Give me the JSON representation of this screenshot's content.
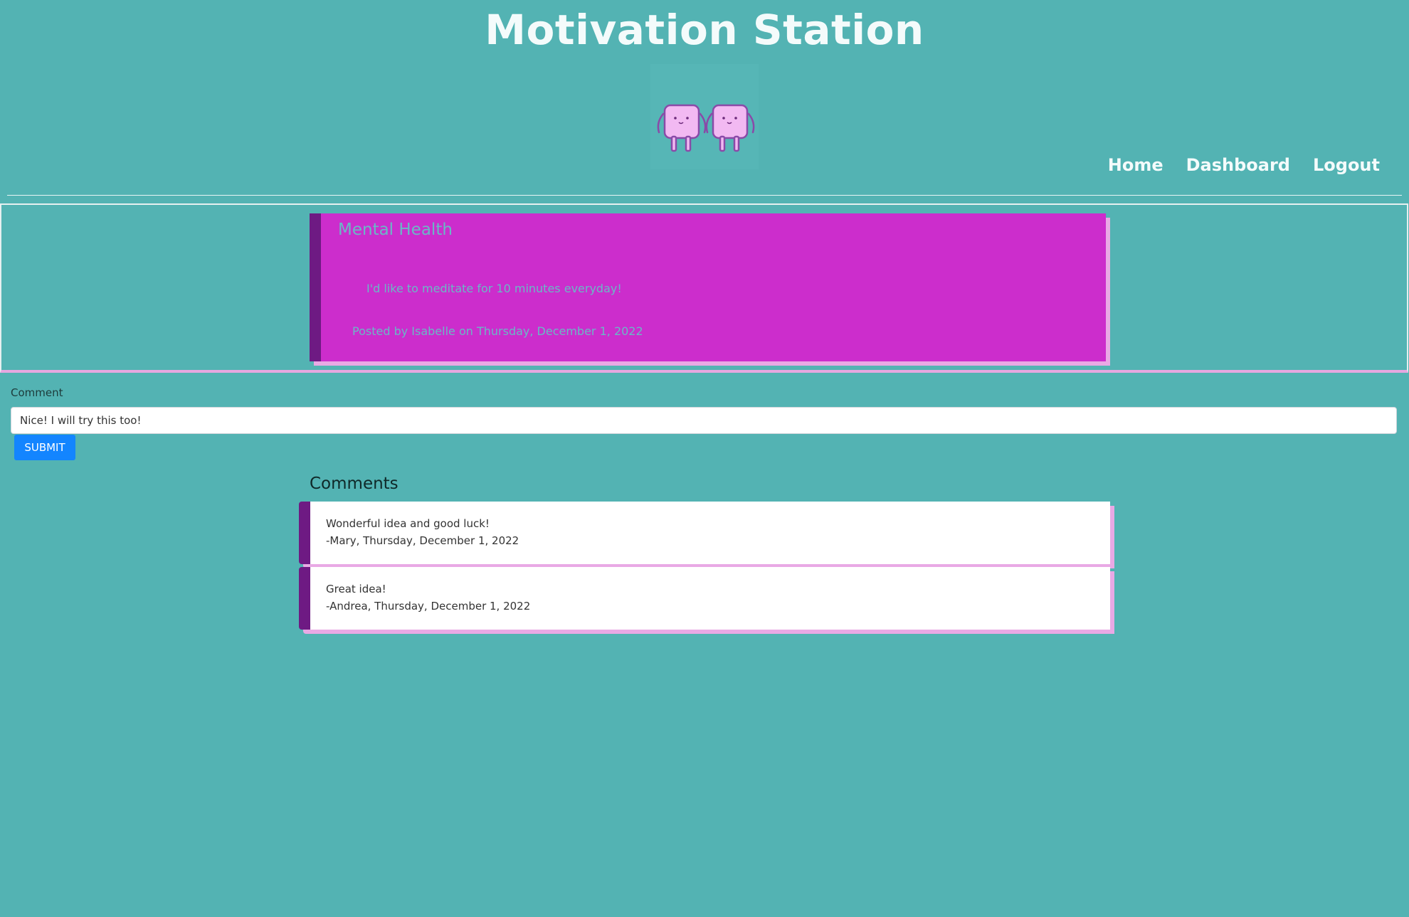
{
  "header": {
    "title": "Motivation Station",
    "logo": "two-pink-cube-mascots-holding-hands"
  },
  "nav": {
    "items": [
      "Home",
      "Dashboard",
      "Logout"
    ]
  },
  "post": {
    "title": "Mental Health",
    "body": "I'd like to meditate for 10 minutes everyday!",
    "meta": "Posted by Isabelle on Thursday, December 1, 2022"
  },
  "comment_form": {
    "label": "Comment",
    "value": "Nice! I will try this too!",
    "submit_label": "SUBMIT"
  },
  "comments": {
    "heading": "Comments",
    "items": [
      {
        "text": "Wonderful idea and good luck!",
        "meta": "-Mary, Thursday, December 1, 2022"
      },
      {
        "text": "Great idea!",
        "meta": "-Andrea, Thursday, December 1, 2022"
      }
    ]
  },
  "colors": {
    "background": "#53b3b3",
    "post_card": "#cc2dcc",
    "card_border": "#6e1a83",
    "card_shadow": "#e9a9e5",
    "submit_button": "#1385ff"
  }
}
